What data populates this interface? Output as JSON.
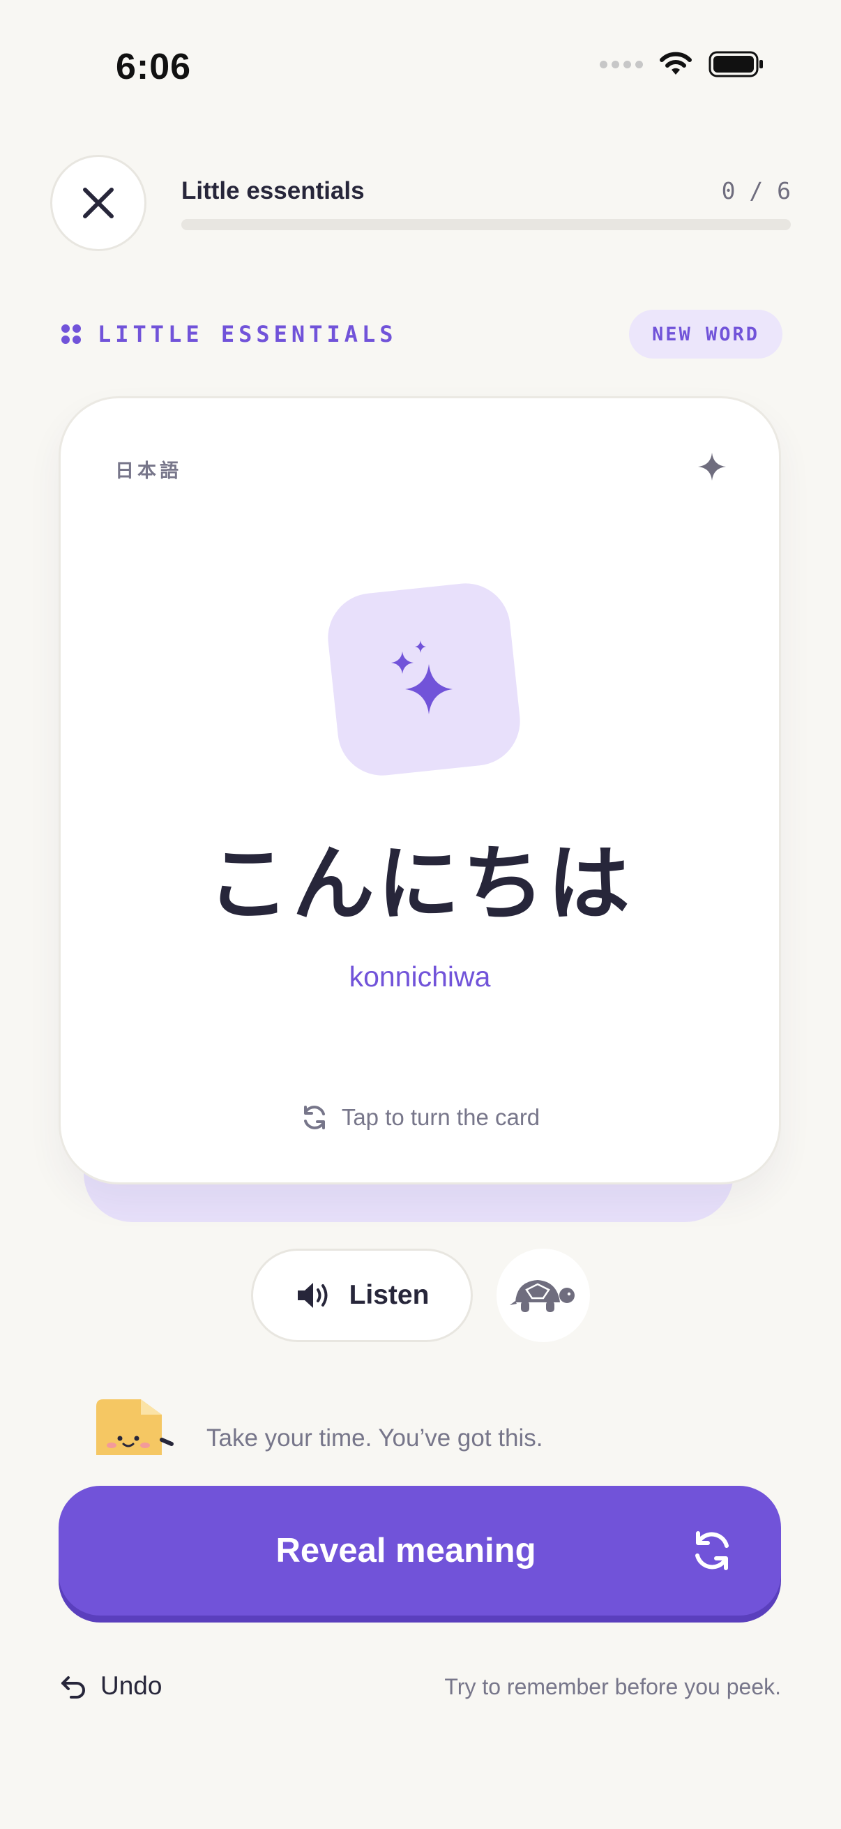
{
  "status_bar": {
    "time": "6:06",
    "icons": [
      "cellular-dots-icon",
      "wifi-icon",
      "battery-icon"
    ]
  },
  "header": {
    "close_icon": "close-icon",
    "lesson_title": "Little essentials",
    "progress_text": "0 / 6",
    "progress_fraction": 0
  },
  "deck": {
    "label": "LITTLE ESSENTIALS",
    "badge": "NEW WORD"
  },
  "card": {
    "language_label": "日本語",
    "word": "こんにちは",
    "romanization": "konnichiwa",
    "tap_hint": "Tap to turn the card"
  },
  "audio": {
    "listen_label": "Listen",
    "slow_icon": "turtle-icon"
  },
  "encouragement": "Take your time. You’ve got this.",
  "actions": {
    "reveal_label": "Reveal meaning",
    "undo_label": "Undo",
    "hint": "Try to remember before you peek."
  },
  "colors": {
    "accent": "#7153d9",
    "accent_light": "#e8e0fb",
    "background": "#f8f7f3",
    "text": "#27263a",
    "muted": "#77768a"
  }
}
